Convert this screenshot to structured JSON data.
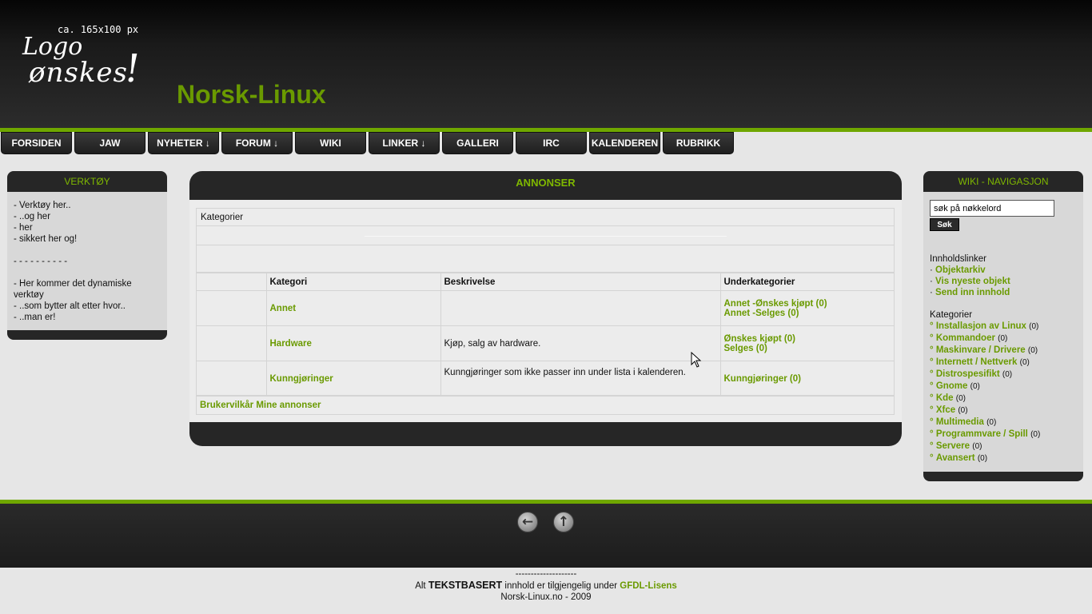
{
  "logo": {
    "size_note": "ca. 165x100 px",
    "line1": "Logo",
    "line2": "ønskes",
    "mark": "!"
  },
  "site_title": "Norsk-Linux",
  "nav": [
    {
      "label": "FORSIDEN"
    },
    {
      "label": "JAW"
    },
    {
      "label": "NYHETER ↓"
    },
    {
      "label": "FORUM ↓"
    },
    {
      "label": "WIKI"
    },
    {
      "label": "LINKER ↓"
    },
    {
      "label": "GALLERI"
    },
    {
      "label": "IRC"
    },
    {
      "label": "KALENDEREN"
    },
    {
      "label": "RUBRIKK"
    }
  ],
  "left_panel": {
    "title": "VERKTØY",
    "lines": [
      "- Verktøy her..",
      "- ..og her",
      "- her",
      "- sikkert her og!",
      "",
      "- - - - - - - - - -",
      "",
      "- Her kommer det dynamiske verktøy",
      "- ..som bytter alt etter hvor..",
      "- ..man er!"
    ]
  },
  "main": {
    "title": "ANNONSER",
    "categories_heading": "Kategorier",
    "columns": [
      "Kategori",
      "Beskrivelse",
      "Underkategorier"
    ],
    "rows": [
      {
        "name": "Annet",
        "description": "",
        "subs": [
          "Annet -Ønskes kjøpt (0)",
          "Annet -Selges (0)"
        ]
      },
      {
        "name": "Hardware",
        "description": "Kjøp, salg av hardware.",
        "subs": [
          "Ønskes kjøpt (0)",
          "Selges (0)"
        ]
      },
      {
        "name": "Kunngjøringer",
        "description": "Kunngjøringer som ikke passer inn under lista i kalenderen.",
        "subs": [
          "Kunngjøringer (0)"
        ]
      }
    ],
    "bottom_links": [
      "Brukervilkår",
      "Mine annonser"
    ]
  },
  "right_panel": {
    "title": "WIKI - NAVIGASJON",
    "search_value": "søk på nøkkelord",
    "search_button": "Søk",
    "content_heading": "Innholdslinker",
    "content_links": [
      "Objektarkiv",
      "Vis nyeste objekt",
      "Send inn innhold"
    ],
    "content_prefix": "·",
    "categories_heading": "Kategorier",
    "category_prefix": "°",
    "categories": [
      {
        "name": "Installasjon av Linux",
        "count": "(0)"
      },
      {
        "name": "Kommandoer",
        "count": "(0)"
      },
      {
        "name": "Maskinvare / Drivere",
        "count": "(0)"
      },
      {
        "name": "Internett / Nettverk",
        "count": "(0)"
      },
      {
        "name": "Distrospesifikt",
        "count": "(0)"
      },
      {
        "name": "Gnome",
        "count": "(0)"
      },
      {
        "name": "Kde",
        "count": "(0)"
      },
      {
        "name": "Xfce",
        "count": "(0)"
      },
      {
        "name": "Multimedia",
        "count": "(0)"
      },
      {
        "name": "Programmvare / Spill",
        "count": "(0)"
      },
      {
        "name": "Servere",
        "count": "(0)"
      },
      {
        "name": "Avansert",
        "count": "(0)"
      }
    ]
  },
  "footer": {
    "back_icon": "arrow-left-icon",
    "up_icon": "arrow-up-icon",
    "dashes": "--------------------",
    "text_prefix": "Alt",
    "text_bold": "TEKSTBASERT",
    "text_middle": "innhold er tilgjengelig under",
    "license_link": "GFDL-Lisens",
    "credit": "Norsk-Linux.no - 2009"
  },
  "colors": {
    "accent": "#6fa700",
    "link": "#6a9a00",
    "dark": "#262626"
  }
}
